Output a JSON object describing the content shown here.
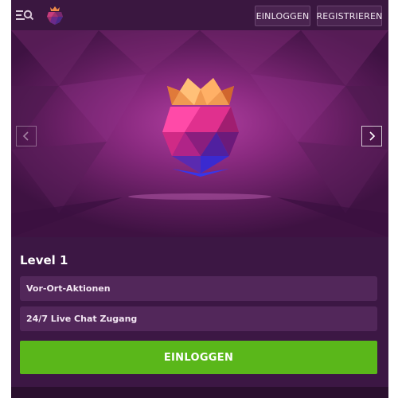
{
  "header": {
    "menu_icon": "menu-search-icon",
    "logo_icon": "raspberry-logo-icon",
    "login_label": "EINLOGGEN",
    "register_label": "REGISTRIEREN"
  },
  "hero": {
    "prev_icon": "chevron-left-icon",
    "next_icon": "chevron-right-icon",
    "gem_icon": "crowned-raspberry-gem-icon"
  },
  "level": {
    "title": "Level 1",
    "features": [
      "Vor-Ort-Aktionen",
      "24/7 Live Chat Zugang"
    ],
    "cta_label": "EINLOGGEN"
  },
  "colors": {
    "background": "#2a0f2e",
    "header": "#3a1740",
    "card": "#3c1744",
    "feature_row": "#52275a",
    "cta": "#5ab71a"
  }
}
